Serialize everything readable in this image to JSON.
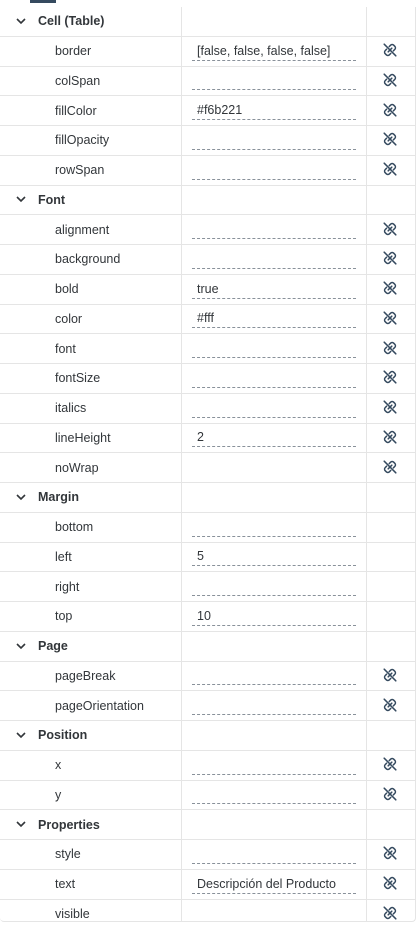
{
  "sections": [
    {
      "label": "Cell (Table)",
      "props": [
        {
          "name": "border",
          "value": "[false, false, false, false]",
          "field": true,
          "link": true
        },
        {
          "name": "colSpan",
          "value": "",
          "field": true,
          "link": true
        },
        {
          "name": "fillColor",
          "value": "#f6b221",
          "field": true,
          "link": true
        },
        {
          "name": "fillOpacity",
          "value": "",
          "field": true,
          "link": true
        },
        {
          "name": "rowSpan",
          "value": "",
          "field": true,
          "link": true
        }
      ]
    },
    {
      "label": "Font",
      "props": [
        {
          "name": "alignment",
          "value": "",
          "field": true,
          "link": true
        },
        {
          "name": "background",
          "value": "",
          "field": true,
          "link": true
        },
        {
          "name": "bold",
          "value": "true",
          "field": true,
          "link": true
        },
        {
          "name": "color",
          "value": "#fff",
          "field": true,
          "link": true
        },
        {
          "name": "font",
          "value": "",
          "field": true,
          "link": true
        },
        {
          "name": "fontSize",
          "value": "",
          "field": true,
          "link": true
        },
        {
          "name": "italics",
          "value": "",
          "field": true,
          "link": true
        },
        {
          "name": "lineHeight",
          "value": "2",
          "field": true,
          "link": true
        },
        {
          "name": "noWrap",
          "value": "",
          "field": false,
          "link": true
        }
      ]
    },
    {
      "label": "Margin",
      "props": [
        {
          "name": "bottom",
          "value": "",
          "field": true,
          "link": false
        },
        {
          "name": "left",
          "value": "5",
          "field": true,
          "link": false
        },
        {
          "name": "right",
          "value": "",
          "field": true,
          "link": false
        },
        {
          "name": "top",
          "value": "10",
          "field": true,
          "link": false
        }
      ]
    },
    {
      "label": "Page",
      "props": [
        {
          "name": "pageBreak",
          "value": "",
          "field": true,
          "link": true
        },
        {
          "name": "pageOrientation",
          "value": "",
          "field": true,
          "link": true
        }
      ]
    },
    {
      "label": "Position",
      "props": [
        {
          "name": "x",
          "value": "",
          "field": true,
          "link": true
        },
        {
          "name": "y",
          "value": "",
          "field": true,
          "link": true
        }
      ]
    },
    {
      "label": "Properties",
      "props": [
        {
          "name": "style",
          "value": "",
          "field": true,
          "link": true
        },
        {
          "name": "text",
          "value": "Descripción del Producto",
          "field": true,
          "link": true
        },
        {
          "name": "visible",
          "value": "",
          "field": false,
          "link": true
        }
      ]
    }
  ],
  "icons": {
    "section_toggle": "chevron-down-icon",
    "binding": "link-icon"
  },
  "colors": {
    "text": "#32363a",
    "border": "#e5e5e5",
    "field_underline": "#89919a",
    "icon": "#354a5f"
  }
}
